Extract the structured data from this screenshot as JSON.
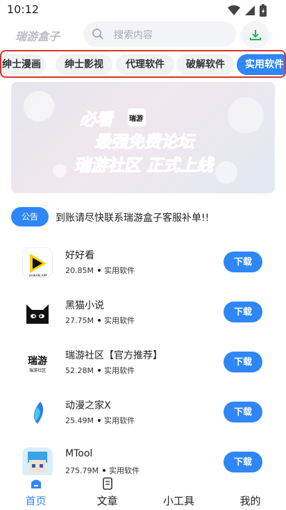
{
  "status_bar": {
    "time": "10:12"
  },
  "header": {
    "app_title": "瑞游盒子",
    "search_placeholder": "搜索内容"
  },
  "categories": [
    {
      "label": "绅士漫画",
      "active": false
    },
    {
      "label": "绅士影视",
      "active": false
    },
    {
      "label": "代理软件",
      "active": false
    },
    {
      "label": "破解软件",
      "active": false
    },
    {
      "label": "实用软件",
      "active": true
    }
  ],
  "banner": {
    "line1": "必看",
    "line2": "最强免费论坛",
    "line3": "瑞游社区 正式上线",
    "logo_text": "瑞游"
  },
  "notice": {
    "badge": "公告",
    "text": "到账请尽快联系瑞游盒子客服补单!!"
  },
  "apps": [
    {
      "name": "好好看",
      "size": "20.85M",
      "category": "实用软件",
      "button": "下载",
      "icon_label": "HHKAN APP"
    },
    {
      "name": "黑猫小说",
      "size": "27.75M",
      "category": "实用软件",
      "button": "下载"
    },
    {
      "name": "瑞游社区【官方推荐】",
      "size": "52.28M",
      "category": "实用软件",
      "button": "下载",
      "icon_label": "瑞游社区"
    },
    {
      "name": "动漫之家X",
      "size": "25.49M",
      "category": "实用软件",
      "button": "下载"
    },
    {
      "name": "MTool",
      "size": "275.79M",
      "category": "实用软件",
      "button": "下载"
    }
  ],
  "tabs": [
    {
      "label": "首页",
      "active": true
    },
    {
      "label": "文章",
      "active": false
    },
    {
      "label": "小工具",
      "active": false
    },
    {
      "label": "我的",
      "active": false
    }
  ],
  "colors": {
    "accent": "#2f86f6",
    "highlight_border": "#d9302a",
    "banner_text": "#e0314a"
  }
}
